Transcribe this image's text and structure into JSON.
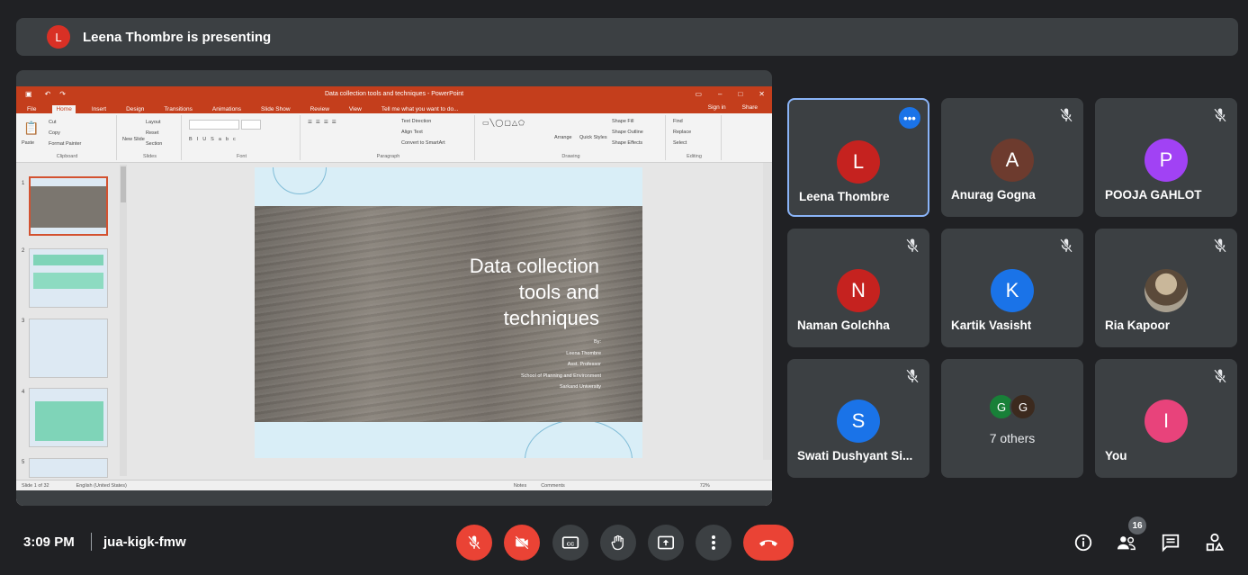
{
  "banner": {
    "initial": "L",
    "text": "Leena Thombre is presenting"
  },
  "powerpoint": {
    "window_title": "Data collection tools and techniques - PowerPoint",
    "tabs": [
      "File",
      "Home",
      "Insert",
      "Design",
      "Transitions",
      "Animations",
      "Slide Show",
      "Review",
      "View"
    ],
    "active_tab": "Home",
    "tell_me": "Tell me what you want to do...",
    "sign_in": "Sign in",
    "share": "Share",
    "groups": [
      "Clipboard",
      "Slides",
      "Font",
      "Paragraph",
      "Drawing",
      "Editing"
    ],
    "clipboard_items": [
      "Cut",
      "Copy",
      "Format Painter",
      "Paste"
    ],
    "slides_items": [
      "Layout",
      "Reset",
      "Section",
      "New Slide"
    ],
    "paragraph_items": [
      "Text Direction",
      "Align Text",
      "Convert to SmartArt"
    ],
    "drawing_items": [
      "Arrange",
      "Quick Styles",
      "Shape Fill",
      "Shape Outline",
      "Shape Effects"
    ],
    "editing_items": [
      "Find",
      "Replace",
      "Select"
    ],
    "slide_numbers": [
      "1",
      "2",
      "3",
      "4",
      "5"
    ],
    "slide": {
      "title_lines": [
        "Data collection",
        "tools and",
        "techniques"
      ],
      "sub_lines": [
        "By:",
        "Leena Thombre",
        "Asst. Professor",
        "School of Planning and Environment",
        "Sarkand University"
      ]
    },
    "status": {
      "slide_of": "Slide 1 of 32",
      "language": "English (United States)",
      "notes": "Notes",
      "comments": "Comments",
      "zoom": "72%"
    }
  },
  "participants": [
    {
      "name": "Leena Thombre",
      "initial": "L",
      "color": "#c5221f",
      "muted": false,
      "active": true
    },
    {
      "name": "Anurag Gogna",
      "initial": "A",
      "color": "#6d3b2e",
      "muted": true,
      "active": false
    },
    {
      "name": "POOJA GAHLOT",
      "initial": "P",
      "color": "#a142f4",
      "muted": true,
      "active": false
    },
    {
      "name": "Naman Golchha",
      "initial": "N",
      "color": "#c5221f",
      "muted": true,
      "active": false
    },
    {
      "name": "Kartik Vasisht",
      "initial": "K",
      "color": "#1a73e8",
      "muted": true,
      "active": false
    },
    {
      "name": "Ria Kapoor",
      "initial": "",
      "color": "#8a7a66",
      "muted": true,
      "active": false
    },
    {
      "name": "Swati Dushyant Si...",
      "initial": "S",
      "color": "#1a73e8",
      "muted": true,
      "active": false
    },
    {
      "name": "7 others",
      "initial": "",
      "color": "#3c4043",
      "muted": false,
      "active": false
    },
    {
      "name": "You",
      "initial": "I",
      "color": "#e8437b",
      "muted": true,
      "active": false
    }
  ],
  "others_tile": {
    "avatars": [
      {
        "initial": "G",
        "color": "#188038"
      },
      {
        "initial": "G",
        "color": "#3c2a1e"
      }
    ],
    "label": "7 others"
  },
  "bottom_bar": {
    "time": "3:09 PM",
    "meeting_code": "jua-kigk-fmw",
    "people_count": "16",
    "controls": [
      "microphone-off",
      "camera-off",
      "captions",
      "raise-hand",
      "present-now",
      "more-options",
      "leave-call"
    ],
    "right_icons": [
      "meeting-details",
      "people",
      "chat",
      "activities"
    ]
  }
}
